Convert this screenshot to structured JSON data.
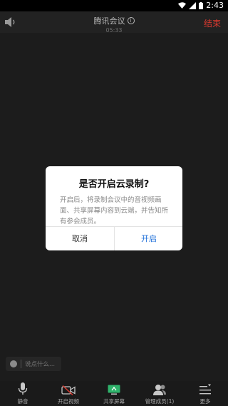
{
  "status_bar": {
    "time": "2:43"
  },
  "top_bar": {
    "title": "腾讯会议",
    "timer": "05:33",
    "end_label": "结束"
  },
  "dialog": {
    "title": "是否开启云录制?",
    "body": "开启后，将录制会议中的音视频画面、共享屏幕内容到云端，并告知所有参会成员。",
    "cancel_label": "取消",
    "confirm_label": "开启"
  },
  "chat": {
    "placeholder": "说点什么..."
  },
  "toolbar": {
    "items": [
      {
        "label": "静音",
        "icon": "mic-icon"
      },
      {
        "label": "开启视频",
        "icon": "video-off-icon"
      },
      {
        "label": "共享屏幕",
        "icon": "share-screen-icon"
      },
      {
        "label": "管理成员(1)",
        "icon": "members-icon"
      },
      {
        "label": "更多",
        "icon": "more-icon"
      }
    ]
  },
  "colors": {
    "end_red": "#d9392f",
    "confirm_blue": "#1e6fd9",
    "share_green": "#2fb36b"
  }
}
